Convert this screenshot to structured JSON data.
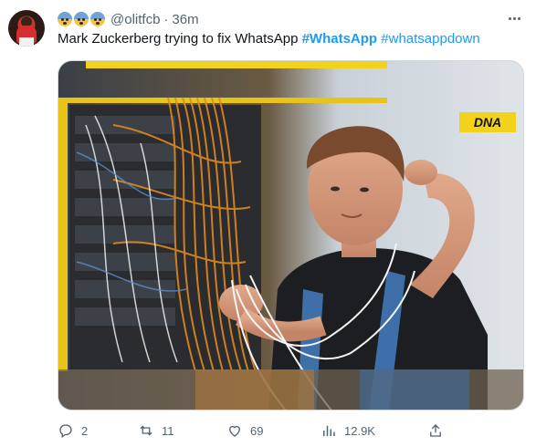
{
  "tweet": {
    "author": {
      "emojis": [
        "anxious-face",
        "anxious-face",
        "anxious-face"
      ],
      "handle": "@olitfcb",
      "separator": "·",
      "time": "36m"
    },
    "text_plain": "Mark Zuckerberg trying to fix WhatsApp ",
    "hashtag_1": "#WhatsApp",
    "hashtag_2": "#whatsappdown",
    "media": {
      "badge": "DNA"
    },
    "actions": {
      "replies": "2",
      "retweets": "11",
      "likes": "69",
      "views": "12.9K"
    }
  },
  "colors": {
    "link": "#1d9bf0",
    "muted": "#536471",
    "text": "#0f1419",
    "badge": "#f2d21b"
  }
}
